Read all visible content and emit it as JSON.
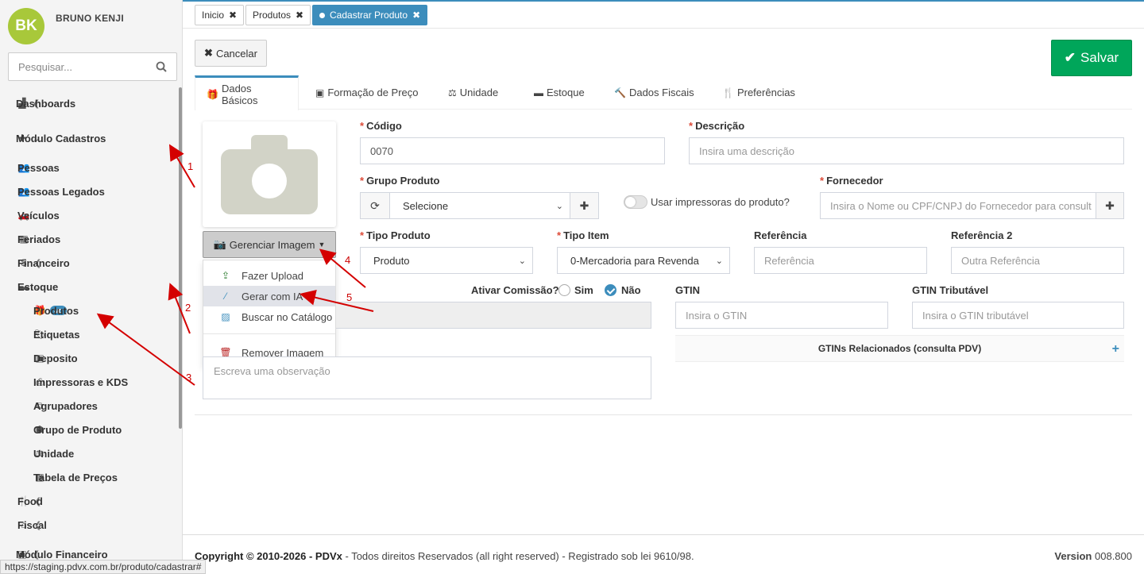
{
  "user": {
    "initials": "BK",
    "name": "BRUNO KENJI"
  },
  "sidebar": {
    "search_placeholder": "Pesquisar...",
    "items": [
      {
        "label": "Dashboards"
      },
      {
        "label": "Módulo Cadastros"
      },
      {
        "label": "Pessoas"
      },
      {
        "label": "Pessoas Legados"
      },
      {
        "label": "Veículos"
      },
      {
        "label": "Feriados"
      },
      {
        "label": "Financeiro"
      },
      {
        "label": "Estoque"
      },
      {
        "label": "Produtos",
        "badge": "up"
      },
      {
        "label": "Etiquetas"
      },
      {
        "label": "Deposito"
      },
      {
        "label": "Impressoras e KDS"
      },
      {
        "label": "Agrupadores"
      },
      {
        "label": "Grupo de Produto"
      },
      {
        "label": "Unidade"
      },
      {
        "label": "Tabela de Preços"
      },
      {
        "label": "Food"
      },
      {
        "label": "Fiscal"
      },
      {
        "label": "Módulo Financeiro"
      }
    ]
  },
  "top_tabs": [
    {
      "label": "Inicio"
    },
    {
      "label": "Produtos"
    },
    {
      "label": "Cadastrar Produto",
      "active": true
    }
  ],
  "actions": {
    "cancel": "Cancelar",
    "save": "Salvar"
  },
  "form_tabs": [
    {
      "label": "Dados Básicos"
    },
    {
      "label": "Formação de Preço"
    },
    {
      "label": "Unidade"
    },
    {
      "label": "Estoque"
    },
    {
      "label": "Dados Fiscais"
    },
    {
      "label": "Preferências"
    }
  ],
  "image": {
    "button": "Gerenciar Imagem",
    "menu": [
      "Fazer Upload",
      "Gerar com IA",
      "Buscar no Catálogo",
      "Remover Imagem"
    ]
  },
  "form": {
    "codigo": {
      "label": "Código",
      "value": "0070"
    },
    "descricao": {
      "label": "Descrição",
      "placeholder": "Insira uma descrição"
    },
    "grupo": {
      "label": "Grupo Produto",
      "value": "Selecione"
    },
    "usar_impressoras": "Usar impressoras do produto?",
    "fornecedor": {
      "label": "Fornecedor",
      "placeholder": "Insira o Nome ou CPF/CNPJ do Fornecedor para consult"
    },
    "tipo_produto": {
      "label": "Tipo Produto",
      "value": "Produto"
    },
    "tipo_item": {
      "label": "Tipo Item",
      "value": "0-Mercadoria para Revenda"
    },
    "referencia": {
      "label": "Referência",
      "placeholder": "Referência"
    },
    "referencia2": {
      "label": "Referência 2",
      "placeholder": "Outra Referência"
    },
    "comissao": {
      "label": "Ativar Comissão?",
      "yes": "Sim",
      "no": "Não",
      "selected": "Não"
    },
    "gtin": {
      "label": "GTIN",
      "placeholder": "Insira o GTIN"
    },
    "gtin_trib": {
      "label": "GTIN Tributável",
      "placeholder": "Insira o GTIN tributável"
    },
    "gtins_relacionados": "GTINs Relacionados (consulta PDV)",
    "observacao": {
      "placeholder": "Escreva uma observação"
    }
  },
  "footer": {
    "copyright": "Copyright © 2010-2026 - PDVx",
    "rights": " - Todos direitos Reservados (all right reserved) - Registrado sob lei 9610/98.",
    "version_label": "Version",
    "version": "008.800"
  },
  "status_url": "https://staging.pdvx.com.br/produto/cadastrar#",
  "annotations": [
    "1",
    "2",
    "3",
    "4",
    "5"
  ]
}
